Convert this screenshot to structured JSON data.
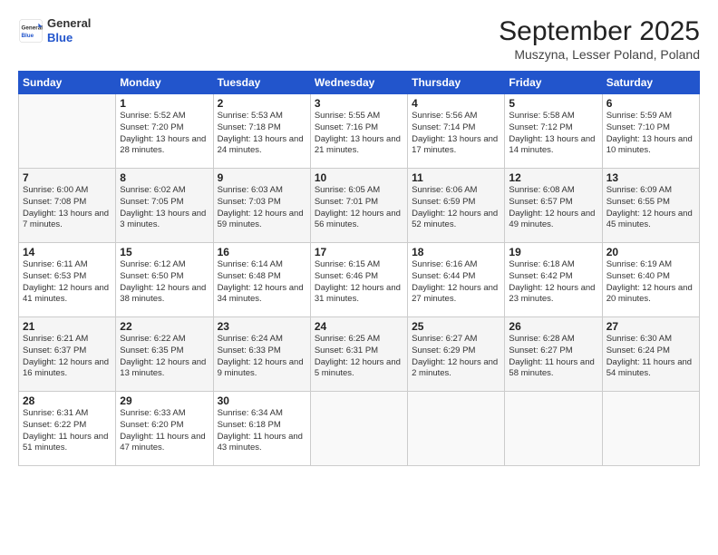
{
  "header": {
    "logo_general": "General",
    "logo_blue": "Blue",
    "month_title": "September 2025",
    "location": "Muszyna, Lesser Poland, Poland"
  },
  "days_of_week": [
    "Sunday",
    "Monday",
    "Tuesday",
    "Wednesday",
    "Thursday",
    "Friday",
    "Saturday"
  ],
  "weeks": [
    [
      {
        "day": "",
        "info": ""
      },
      {
        "day": "1",
        "info": "Sunrise: 5:52 AM\nSunset: 7:20 PM\nDaylight: 13 hours\nand 28 minutes."
      },
      {
        "day": "2",
        "info": "Sunrise: 5:53 AM\nSunset: 7:18 PM\nDaylight: 13 hours\nand 24 minutes."
      },
      {
        "day": "3",
        "info": "Sunrise: 5:55 AM\nSunset: 7:16 PM\nDaylight: 13 hours\nand 21 minutes."
      },
      {
        "day": "4",
        "info": "Sunrise: 5:56 AM\nSunset: 7:14 PM\nDaylight: 13 hours\nand 17 minutes."
      },
      {
        "day": "5",
        "info": "Sunrise: 5:58 AM\nSunset: 7:12 PM\nDaylight: 13 hours\nand 14 minutes."
      },
      {
        "day": "6",
        "info": "Sunrise: 5:59 AM\nSunset: 7:10 PM\nDaylight: 13 hours\nand 10 minutes."
      }
    ],
    [
      {
        "day": "7",
        "info": "Sunrise: 6:00 AM\nSunset: 7:08 PM\nDaylight: 13 hours\nand 7 minutes."
      },
      {
        "day": "8",
        "info": "Sunrise: 6:02 AM\nSunset: 7:05 PM\nDaylight: 13 hours\nand 3 minutes."
      },
      {
        "day": "9",
        "info": "Sunrise: 6:03 AM\nSunset: 7:03 PM\nDaylight: 12 hours\nand 59 minutes."
      },
      {
        "day": "10",
        "info": "Sunrise: 6:05 AM\nSunset: 7:01 PM\nDaylight: 12 hours\nand 56 minutes."
      },
      {
        "day": "11",
        "info": "Sunrise: 6:06 AM\nSunset: 6:59 PM\nDaylight: 12 hours\nand 52 minutes."
      },
      {
        "day": "12",
        "info": "Sunrise: 6:08 AM\nSunset: 6:57 PM\nDaylight: 12 hours\nand 49 minutes."
      },
      {
        "day": "13",
        "info": "Sunrise: 6:09 AM\nSunset: 6:55 PM\nDaylight: 12 hours\nand 45 minutes."
      }
    ],
    [
      {
        "day": "14",
        "info": "Sunrise: 6:11 AM\nSunset: 6:53 PM\nDaylight: 12 hours\nand 41 minutes."
      },
      {
        "day": "15",
        "info": "Sunrise: 6:12 AM\nSunset: 6:50 PM\nDaylight: 12 hours\nand 38 minutes."
      },
      {
        "day": "16",
        "info": "Sunrise: 6:14 AM\nSunset: 6:48 PM\nDaylight: 12 hours\nand 34 minutes."
      },
      {
        "day": "17",
        "info": "Sunrise: 6:15 AM\nSunset: 6:46 PM\nDaylight: 12 hours\nand 31 minutes."
      },
      {
        "day": "18",
        "info": "Sunrise: 6:16 AM\nSunset: 6:44 PM\nDaylight: 12 hours\nand 27 minutes."
      },
      {
        "day": "19",
        "info": "Sunrise: 6:18 AM\nSunset: 6:42 PM\nDaylight: 12 hours\nand 23 minutes."
      },
      {
        "day": "20",
        "info": "Sunrise: 6:19 AM\nSunset: 6:40 PM\nDaylight: 12 hours\nand 20 minutes."
      }
    ],
    [
      {
        "day": "21",
        "info": "Sunrise: 6:21 AM\nSunset: 6:37 PM\nDaylight: 12 hours\nand 16 minutes."
      },
      {
        "day": "22",
        "info": "Sunrise: 6:22 AM\nSunset: 6:35 PM\nDaylight: 12 hours\nand 13 minutes."
      },
      {
        "day": "23",
        "info": "Sunrise: 6:24 AM\nSunset: 6:33 PM\nDaylight: 12 hours\nand 9 minutes."
      },
      {
        "day": "24",
        "info": "Sunrise: 6:25 AM\nSunset: 6:31 PM\nDaylight: 12 hours\nand 5 minutes."
      },
      {
        "day": "25",
        "info": "Sunrise: 6:27 AM\nSunset: 6:29 PM\nDaylight: 12 hours\nand 2 minutes."
      },
      {
        "day": "26",
        "info": "Sunrise: 6:28 AM\nSunset: 6:27 PM\nDaylight: 11 hours\nand 58 minutes."
      },
      {
        "day": "27",
        "info": "Sunrise: 6:30 AM\nSunset: 6:24 PM\nDaylight: 11 hours\nand 54 minutes."
      }
    ],
    [
      {
        "day": "28",
        "info": "Sunrise: 6:31 AM\nSunset: 6:22 PM\nDaylight: 11 hours\nand 51 minutes."
      },
      {
        "day": "29",
        "info": "Sunrise: 6:33 AM\nSunset: 6:20 PM\nDaylight: 11 hours\nand 47 minutes."
      },
      {
        "day": "30",
        "info": "Sunrise: 6:34 AM\nSunset: 6:18 PM\nDaylight: 11 hours\nand 43 minutes."
      },
      {
        "day": "",
        "info": ""
      },
      {
        "day": "",
        "info": ""
      },
      {
        "day": "",
        "info": ""
      },
      {
        "day": "",
        "info": ""
      }
    ]
  ]
}
